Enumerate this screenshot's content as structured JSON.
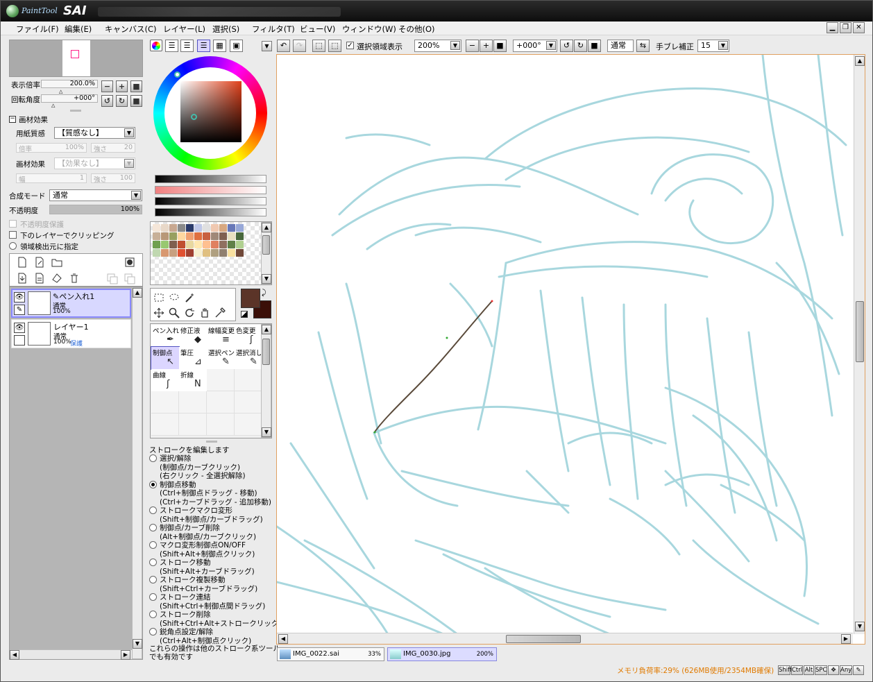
{
  "app": {
    "logo_small": "PaintTool",
    "logo_name": "SAI"
  },
  "menu": [
    "ファイル(F)",
    "編集(E)",
    "キャンバス(C)",
    "レイヤー(L)",
    "選択(S)",
    "フィルタ(T)",
    "ビュー(V)",
    "ウィンドウ(W)",
    "その他(O)"
  ],
  "navigator": {
    "zoom_label": "表示倍率",
    "zoom_value": "200.0%",
    "rotate_label": "回転角度",
    "rotate_value": "+000°"
  },
  "texture": {
    "header": "画材効果",
    "paper_label": "用紙質感",
    "paper_value": "【質感なし】",
    "scale_label": "倍率",
    "scale_value": "100%",
    "strength_label": "強さ",
    "strength_value": "20",
    "effect_label": "画材効果",
    "effect_value": "【効果なし】",
    "width_label": "幅",
    "width_value": "1",
    "strength2_label": "強さ",
    "strength2_value": "100"
  },
  "layer_props": {
    "blend_label": "合成モード",
    "blend_value": "通常",
    "opacity_label": "不透明度",
    "opacity_value": "100%",
    "opacity_fraction": 1.0,
    "protect_opacity": "不透明度保護",
    "clip": "下のレイヤーでクリッピング",
    "area_detect": "領域検出元に指定"
  },
  "layers": [
    {
      "name": "ペン入れ1",
      "mode": "通常",
      "opacity": "100%",
      "protect": "",
      "selected": true
    },
    {
      "name": "レイヤー1",
      "mode": "通常",
      "opacity": "100%",
      "protect": "保護",
      "selected": false
    }
  ],
  "tools": [
    {
      "label": "ペン入れ",
      "icon": "pen-icon"
    },
    {
      "label": "修正液",
      "icon": "eraser-icon"
    },
    {
      "label": "線幅変更",
      "icon": "line-width-icon"
    },
    {
      "label": "色変更",
      "icon": "color-change-icon"
    },
    {
      "label": "制御点",
      "icon": "control-point-icon"
    },
    {
      "label": "筆圧",
      "icon": "pressure-icon"
    },
    {
      "label": "選択ペン",
      "icon": "select-pen-icon"
    },
    {
      "label": "選択消し",
      "icon": "select-erase-icon"
    },
    {
      "label": "曲線",
      "icon": "curve-icon"
    },
    {
      "label": "折線",
      "icon": "polyline-icon"
    }
  ],
  "help": {
    "title": "ストロークを編集します",
    "options": [
      {
        "label": "選択/解除",
        "notes": [
          "(制御点/カーブクリック)",
          "(右クリック - 全選択解除)"
        ],
        "on": false
      },
      {
        "label": "制御点移動",
        "notes": [
          "(Ctrl+制御点ドラッグ - 移動)",
          "(Ctrl+カーブドラッグ - 追加移動)"
        ],
        "on": true
      },
      {
        "label": "ストロークマクロ変形",
        "notes": [
          "(Shift+制御点/カーブドラッグ)"
        ],
        "on": false
      },
      {
        "label": "制御点/カーブ削除",
        "notes": [
          "(Alt+制御点/カーブクリック)"
        ],
        "on": false
      },
      {
        "label": "マクロ変形制御点ON/OFF",
        "notes": [
          "(Shift+Alt+制御点クリック)"
        ],
        "on": false
      },
      {
        "label": "ストローク移動",
        "notes": [
          "(Shift+Alt+カーブドラッグ)"
        ],
        "on": false
      },
      {
        "label": "ストローク複製移動",
        "notes": [
          "(Shift+Ctrl+カーブドラッグ)"
        ],
        "on": false
      },
      {
        "label": "ストローク連結",
        "notes": [
          "(Shift+Ctrl+制御点間ドラッグ)"
        ],
        "on": false
      },
      {
        "label": "ストローク削除",
        "notes": [
          "(Shift+Ctrl+Alt+ストロークリック)"
        ],
        "on": false
      },
      {
        "label": "鋭角点設定/解除",
        "notes": [
          "(Ctrl+Alt+制御点クリック)"
        ],
        "on": false
      }
    ],
    "footer1": "これらの操作は他のストローク系ツール",
    "footer2": "でも有効です"
  },
  "toolbar": {
    "show_selection": "選択領域表示",
    "zoom": "200%",
    "angle": "+000°",
    "blend": "通常",
    "stabilizer_label": "手ブレ補正",
    "stabilizer_value": "15"
  },
  "tabs": [
    {
      "name": "IMG_0022.sai",
      "zoom": "33%",
      "active": false
    },
    {
      "name": "IMG_0030.jpg",
      "zoom": "200%",
      "active": true
    }
  ],
  "status": {
    "memory": "メモリ負荷率:29% (626MB使用/2354MB確保)",
    "keys": [
      "Shift",
      "Ctrl",
      "Alt",
      "SPC",
      "Any"
    ]
  },
  "colors": {
    "main": "#5b3428",
    "sub": "#3b0f08",
    "sketch": "#8ccad4",
    "stroke": "#5a4a3a",
    "selected_layer": "#d8d8ff"
  },
  "swatches": [
    "#f5e6d8",
    "#e8d8c8",
    "#c8a890",
    "#8a8a8a",
    "#2a3a6a",
    "#c0c8e8",
    "#e0e0e0",
    "#f0c8b0",
    "#d8a880",
    "#6878b8",
    "#98a8d8",
    "#c8b098",
    "#b89878",
    "#98a060",
    "#ffd8a0",
    "#f0a070",
    "#e07040",
    "#c86040",
    "#a08878",
    "#806050",
    "#e8e0c0",
    "#48683c",
    "#70a050",
    "#98c870",
    "#806050",
    "#c05030",
    "#e8d8a0",
    "#ffe8b0",
    "#ffc090",
    "#e08060",
    "#907060",
    "#608048",
    "#b0d090",
    "#c0d8b0",
    "#d89870",
    "#c8a080",
    "#e05030",
    "#a04030",
    "#f8f0d0",
    "#e0c080",
    "#b0a080",
    "#908070",
    "#f8e0a0",
    "#704838"
  ]
}
